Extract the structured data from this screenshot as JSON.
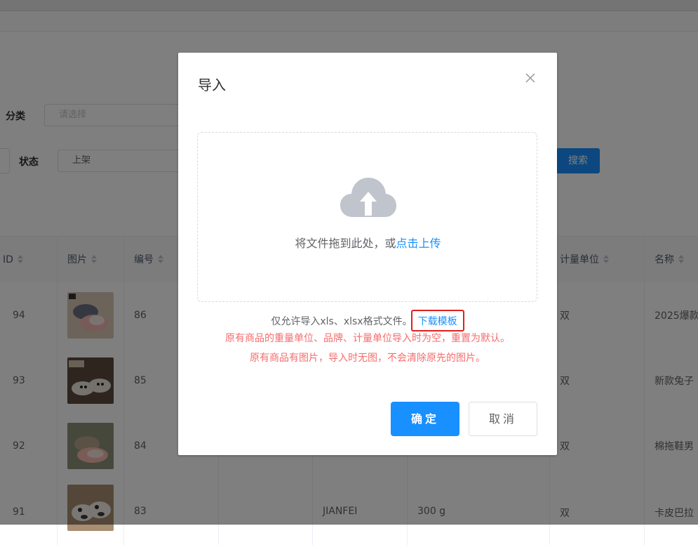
{
  "filters": {
    "category_label": "分类",
    "category_placeholder": "请选择",
    "status_label": "状态",
    "status_value": "上架",
    "search_button": "搜索"
  },
  "table": {
    "headers": [
      "ID",
      "图片",
      "编号",
      "计量单位",
      "名称"
    ],
    "rows": [
      {
        "id": "94",
        "number": "86",
        "brand": "",
        "weight": "",
        "unit": "双",
        "name": "2025爆款"
      },
      {
        "id": "93",
        "number": "85",
        "brand": "",
        "weight": "",
        "unit": "双",
        "name": "新款兔子"
      },
      {
        "id": "92",
        "number": "84",
        "brand": "",
        "weight": "",
        "unit": "双",
        "name": "棉拖鞋男"
      },
      {
        "id": "91",
        "number": "83",
        "brand": "JIANFEI",
        "weight": "300 g",
        "unit": "双",
        "name": "卡皮巴拉"
      }
    ]
  },
  "dialog": {
    "title": "导入",
    "close_icon": "close-icon",
    "upload_icon": "cloud-upload-icon",
    "drag_text": "将文件拖到此处，或",
    "click_upload": "点击上传",
    "allowed_text": "仅允许导入xls、xlsx格式文件。",
    "download_template": "下载模板",
    "note1": "原有商品的重量单位、品牌、计量单位导入时为空，重置为默认。",
    "note2": "原有商品有图片，导入时无图，不会清除原先的图片。",
    "confirm_button": "确定",
    "cancel_button": "取消"
  },
  "colors": {
    "primary": "#1890ff",
    "warning_text": "#f56c6c",
    "highlight_box": "#e02020"
  }
}
